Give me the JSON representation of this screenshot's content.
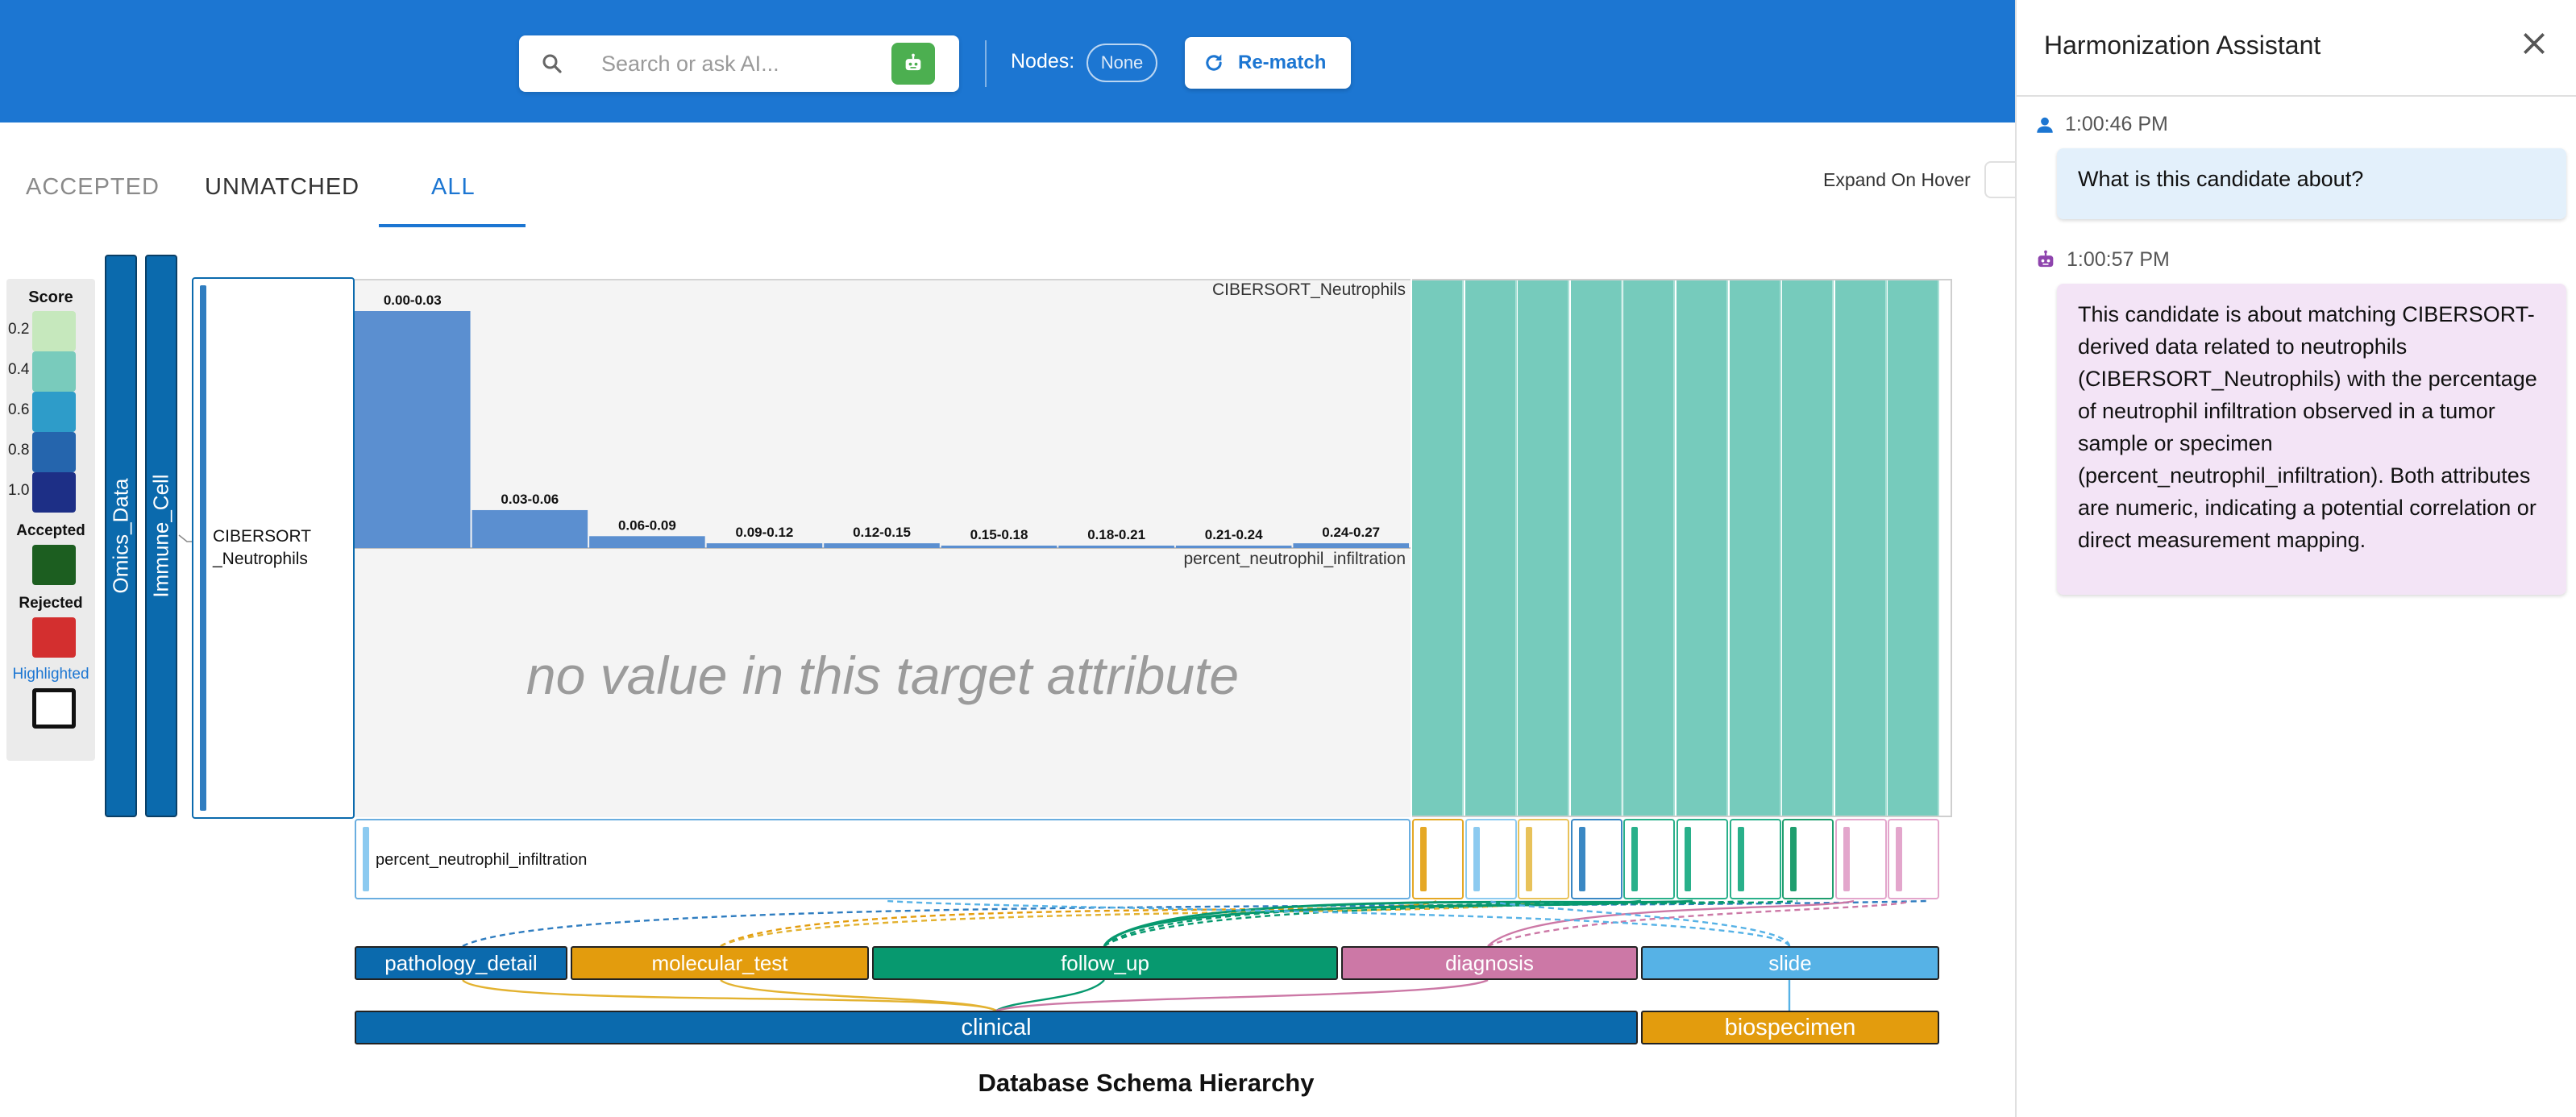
{
  "header": {
    "search_placeholder": "Search or ask AI...",
    "nodes_label": "Nodes:",
    "nodes_value": "None",
    "rematch_label": "Re-match"
  },
  "tabs": [
    {
      "label": "ACCEPTED",
      "active": false
    },
    {
      "label": "UNMATCHED",
      "active": false
    },
    {
      "label": "ALL",
      "active": true
    }
  ],
  "expand_on_hover_label": "Expand On Hover",
  "legend": {
    "title": "Score",
    "scores": [
      {
        "label": "0.2",
        "color": "#c6e8bd"
      },
      {
        "label": "0.4",
        "color": "#79cbbc"
      },
      {
        "label": "0.6",
        "color": "#2e9cc9"
      },
      {
        "label": "0.8",
        "color": "#2565ad"
      },
      {
        "label": "1.0",
        "color": "#1d2f86"
      }
    ],
    "accepted_label": "Accepted",
    "accepted_color": "#1c5e20",
    "rejected_label": "Rejected",
    "rejected_color": "#d32f2f",
    "highlighted_label": "Highlighted"
  },
  "hierarchy": {
    "level1": "Omics_Data",
    "level2": "Immune_Cell",
    "source_attribute": "CIBERSORT\n_Neutrophils"
  },
  "histogram": {
    "source_title": "CIBERSORT_Neutrophils",
    "target_title": "percent_neutrophil_infiltration",
    "empty_message": "no value in this target attribute"
  },
  "chart_data": {
    "type": "bar",
    "title": "CIBERSORT_Neutrophils",
    "categories": [
      "0.00-0.03",
      "0.03-0.06",
      "0.06-0.09",
      "0.09-0.12",
      "0.12-0.15",
      "0.15-0.18",
      "0.18-0.21",
      "0.21-0.24",
      "0.24-0.27"
    ],
    "values": [
      100,
      16,
      5,
      2,
      2,
      1,
      0,
      0,
      2
    ]
  },
  "target_attribute": "percent_neutrophil_infiltration",
  "candidates": [
    {
      "color": "#e5a825"
    },
    {
      "color": "#8ccaf0"
    },
    {
      "color": "#e8c25a"
    },
    {
      "color": "#3a88c4"
    },
    {
      "color": "#29b08a"
    },
    {
      "color": "#29b08a"
    },
    {
      "color": "#29b08a"
    },
    {
      "color": "#1f9e6e"
    },
    {
      "color": "#e3a6cc"
    },
    {
      "color": "#e3a6cc"
    }
  ],
  "schema": {
    "categories": [
      {
        "label": "pathology_detail",
        "color": "#0b6aad"
      },
      {
        "label": "molecular_test",
        "color": "#e39c0d"
      },
      {
        "label": "follow_up",
        "color": "#07996f"
      },
      {
        "label": "diagnosis",
        "color": "#cc78a6"
      },
      {
        "label": "slide",
        "color": "#56b2e6"
      }
    ],
    "groups": [
      {
        "label": "clinical",
        "color": "#0b6aad"
      },
      {
        "label": "biospecimen",
        "color": "#e39c0d"
      }
    ],
    "title": "Database Schema Hierarchy"
  },
  "assistant": {
    "title": "Harmonization Assistant",
    "messages": [
      {
        "role": "user",
        "time": "1:00:46 PM",
        "text": "What is this candidate about?"
      },
      {
        "role": "bot",
        "time": "1:00:57 PM",
        "text": "This candidate is about matching CIBERSORT-derived data related to neutrophils (CIBERSORT_Neutrophils) with the percentage of neutrophil infiltration observed in a tumor sample or specimen (percent_neutrophil_infiltration). Both attributes are numeric, indicating a potential correlation or direct measurement mapping."
      }
    ]
  }
}
